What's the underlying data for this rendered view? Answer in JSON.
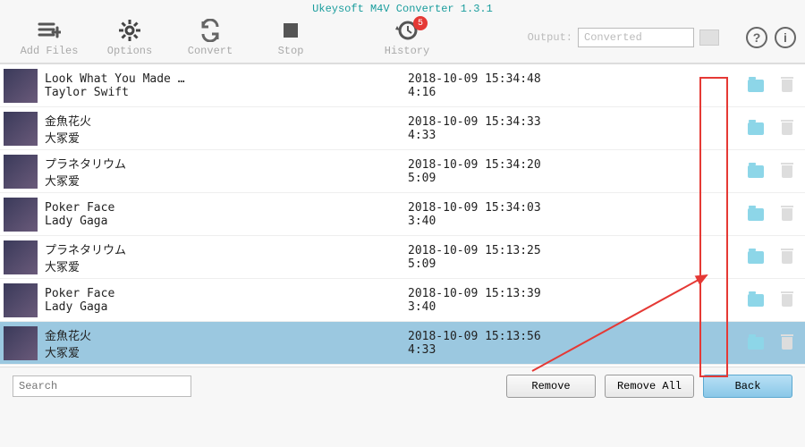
{
  "app": {
    "title": "Ukeysoft M4V Converter 1.3.1"
  },
  "toolbar": {
    "add_files": "Add Files",
    "options": "Options",
    "convert": "Convert",
    "stop": "Stop",
    "history": "History",
    "history_badge": "5",
    "output_label": "Output:",
    "output_value": "Converted"
  },
  "search_placeholder": "Search",
  "buttons": {
    "remove": "Remove",
    "remove_all": "Remove All",
    "back": "Back"
  },
  "rows": [
    {
      "title": "Look What You Made …",
      "artist": "Taylor Swift",
      "ts": "2018-10-09 15:34:48",
      "dur": "4:16",
      "selected": false
    },
    {
      "title": "金魚花火",
      "artist": "大冢爱",
      "ts": "2018-10-09 15:34:33",
      "dur": "4:33",
      "selected": false
    },
    {
      "title": "プラネタリウム",
      "artist": "大冢爱",
      "ts": "2018-10-09 15:34:20",
      "dur": "5:09",
      "selected": false
    },
    {
      "title": "Poker Face",
      "artist": "Lady Gaga",
      "ts": "2018-10-09 15:34:03",
      "dur": "3:40",
      "selected": false
    },
    {
      "title": "プラネタリウム",
      "artist": "大冢爱",
      "ts": "2018-10-09 15:13:25",
      "dur": "5:09",
      "selected": false
    },
    {
      "title": "Poker Face",
      "artist": "Lady Gaga",
      "ts": "2018-10-09 15:13:39",
      "dur": "3:40",
      "selected": false
    },
    {
      "title": "金魚花火",
      "artist": "大冢爱",
      "ts": "2018-10-09 15:13:56",
      "dur": "4:33",
      "selected": true
    }
  ]
}
